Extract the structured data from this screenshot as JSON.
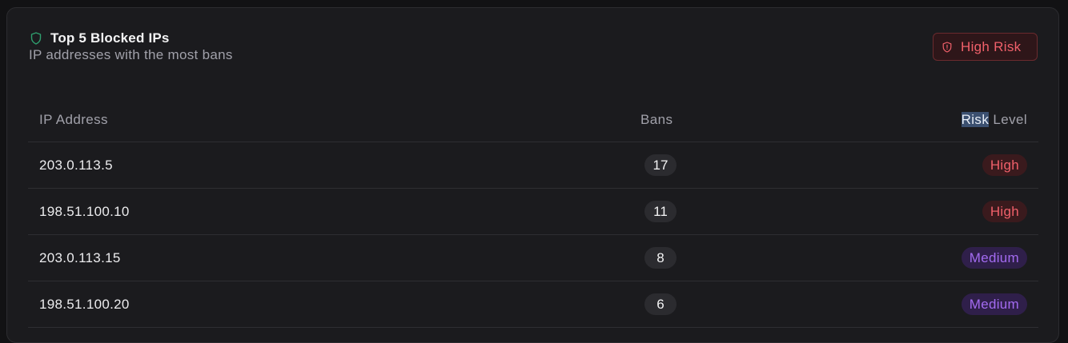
{
  "header": {
    "title": "Top 5 Blocked IPs",
    "subtitle": "IP addresses with the most bans",
    "badge_label": "High Risk",
    "title_icon": "shield-icon",
    "badge_icon": "shield-alert-icon"
  },
  "table": {
    "columns": {
      "ip": "IP Address",
      "bans": "Bans",
      "risk_highlighted": "Risk",
      "risk_rest": " Level"
    },
    "rows": [
      {
        "ip": "203.0.113.5",
        "bans": "17",
        "level": "High"
      },
      {
        "ip": "198.51.100.10",
        "bans": "11",
        "level": "High"
      },
      {
        "ip": "203.0.113.15",
        "bans": "8",
        "level": "Medium"
      },
      {
        "ip": "198.51.100.20",
        "bans": "6",
        "level": "Medium"
      }
    ]
  },
  "colors": {
    "card_background": "#1b1b1e",
    "high": "#f0606a",
    "medium": "#a36bf0",
    "shield_icon": "#2f9e6e"
  }
}
